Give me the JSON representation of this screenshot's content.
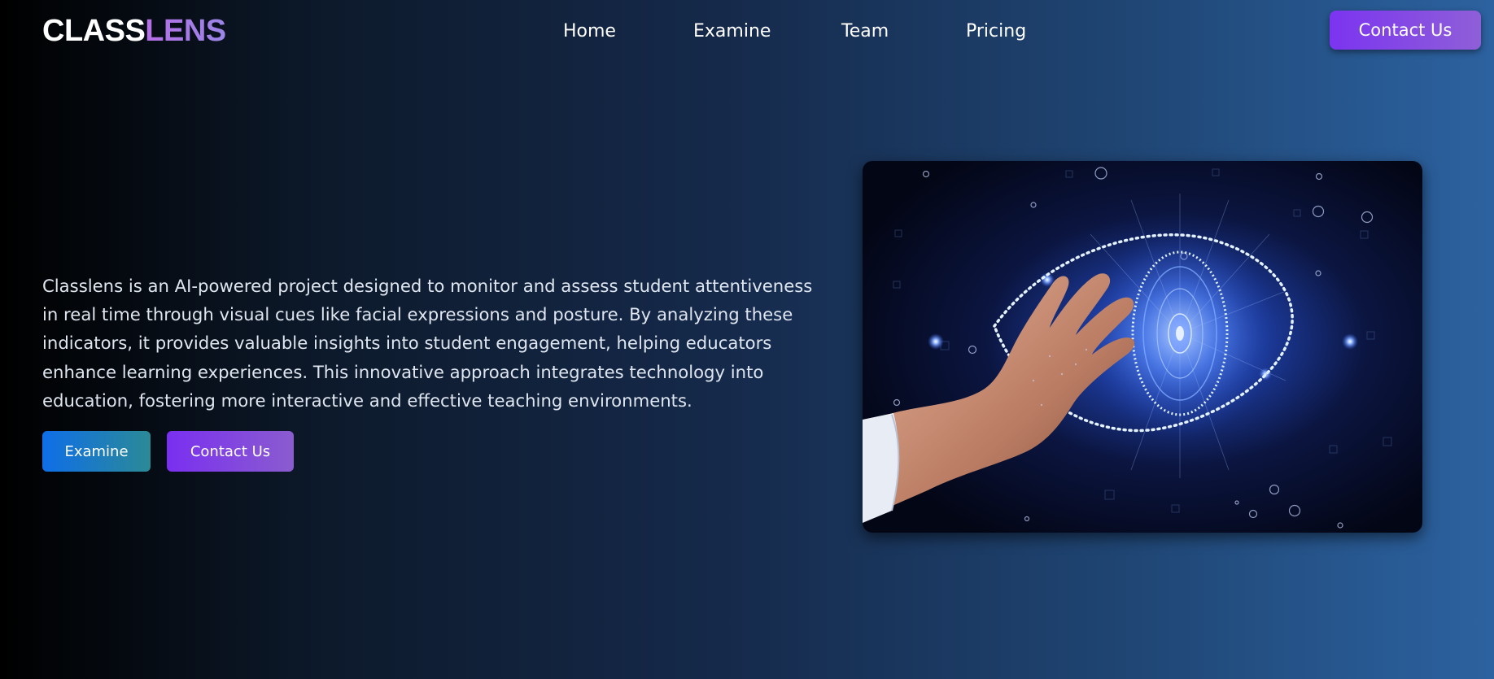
{
  "logo": {
    "part1": "CLASS",
    "part2": "LENS"
  },
  "nav": {
    "links": [
      {
        "label": "Home"
      },
      {
        "label": "Examine"
      },
      {
        "label": "Team"
      },
      {
        "label": "Pricing"
      }
    ],
    "contact_label": "Contact Us"
  },
  "hero": {
    "description": "Classlens is an AI-powered project designed to monitor and assess student attentiveness in real time through visual cues like facial expressions and posture. By analyzing these indicators, it provides valuable insights into student engagement, helping educators enhance learning experiences. This innovative approach integrates technology into education, fostering more interactive and effective teaching environments.",
    "examine_label": "Examine",
    "contact_label": "Contact Us"
  },
  "colors": {
    "accent_purple": "#7b34f0",
    "accent_blue": "#0f6ee8",
    "logo_lens": "#b56fe6"
  },
  "icons": {
    "hero_image": "hand-touching-digital-eye"
  }
}
